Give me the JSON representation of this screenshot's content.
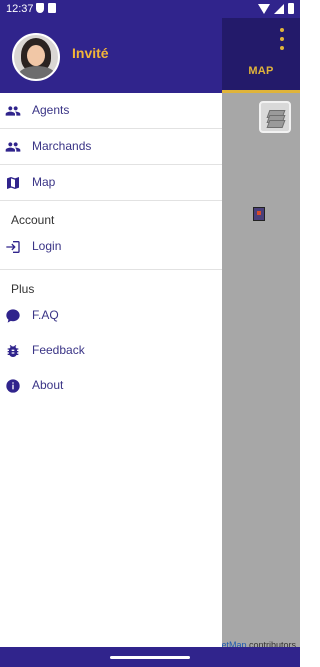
{
  "status_bar": {
    "time": "12:37"
  },
  "drawer": {
    "username": "Invité",
    "items_group1": [
      {
        "label": "Agents",
        "icon": "people-icon"
      },
      {
        "label": "Marchands",
        "icon": "people-icon"
      },
      {
        "label": "Map",
        "icon": "map-icon"
      }
    ],
    "section_account": "Account",
    "login_label": "Login",
    "section_plus": "Plus",
    "faq_label": "F.AQ",
    "feedback_label": "Feedback",
    "about_label": "About"
  },
  "app": {
    "tab_label": "MAP",
    "attribution_link": "etMap",
    "attribution_rest": " contributors"
  },
  "colors": {
    "primary": "#30248c",
    "accent": "#f2b538",
    "map_bg": "#a7a7a7"
  }
}
